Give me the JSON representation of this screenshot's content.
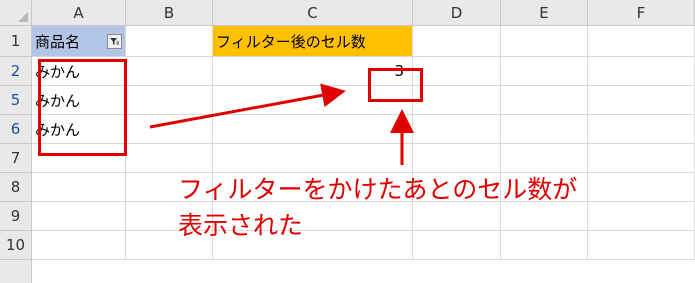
{
  "columns": [
    "A",
    "B",
    "C",
    "D",
    "E",
    "F"
  ],
  "rows": [
    "1",
    "2",
    "5",
    "6",
    "7",
    "8",
    "9",
    "10"
  ],
  "cells": {
    "A1": "商品名",
    "C1": "フィルター後のセル数",
    "A2": "みかん",
    "A5": "みかん",
    "A6": "みかん",
    "C2": "3"
  },
  "annotation": {
    "line1": "フィルターをかけたあとのセル数が",
    "line2": "表示された"
  },
  "colors": {
    "header_fill_A1": "#b4c6e7",
    "header_fill_C1": "#ffc000",
    "annotation_red": "#e00000",
    "filtered_row_number": "#1f4ea3"
  },
  "icons": {
    "filter_button": "filter-funnel-icon"
  }
}
